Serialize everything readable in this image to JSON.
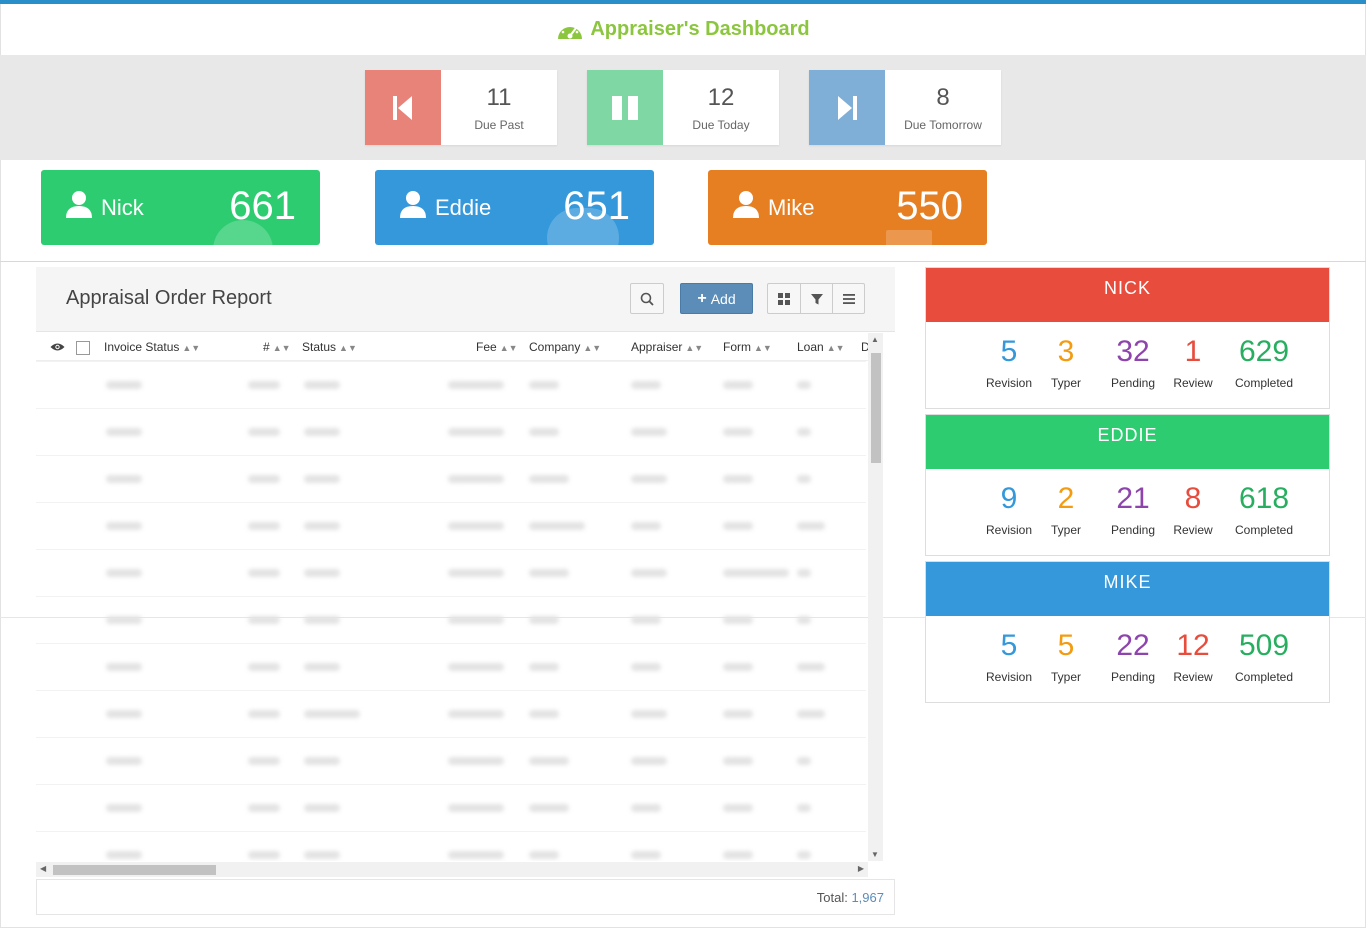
{
  "header": {
    "title": "Appraiser's Dashboard"
  },
  "due": [
    {
      "count": "11",
      "label": "Due Past",
      "color": "#e8837a"
    },
    {
      "count": "12",
      "label": "Due Today",
      "color": "#7fd8a3"
    },
    {
      "count": "8",
      "label": "Due Tomorrow",
      "color": "#7faed6"
    }
  ],
  "users": [
    {
      "name": "Nick",
      "count": "661",
      "color": "#2ecc71"
    },
    {
      "name": "Eddie",
      "count": "651",
      "color": "#3498db"
    },
    {
      "name": "Mike",
      "count": "550",
      "color": "#e67e22"
    }
  ],
  "report": {
    "title": "Appraisal Order Report",
    "add_label": "Add",
    "columns": [
      "Invoice Status",
      "#",
      "Status",
      "Fee",
      "Company",
      "Appraiser",
      "Form",
      "Loan",
      "D"
    ],
    "total_label": "Total:",
    "total_value": "1,967"
  },
  "stats": [
    {
      "name": "NICK",
      "color": "#e74c3c",
      "revision": "5",
      "typer": "3",
      "pending": "32",
      "review": "1",
      "completed": "629"
    },
    {
      "name": "EDDIE",
      "color": "#2ecc71",
      "revision": "9",
      "typer": "2",
      "pending": "21",
      "review": "8",
      "completed": "618"
    },
    {
      "name": "MIKE",
      "color": "#3498db",
      "revision": "5",
      "typer": "5",
      "pending": "22",
      "review": "12",
      "completed": "509"
    }
  ],
  "stat_labels": {
    "revision": "Revision",
    "typer": "Typer",
    "pending": "Pending",
    "review": "Review",
    "completed": "Completed"
  },
  "stat_colors": {
    "revision": "#3498db",
    "typer": "#f39c12",
    "pending": "#8e44ad",
    "review": "#e74c3c",
    "completed": "#27ae60"
  }
}
